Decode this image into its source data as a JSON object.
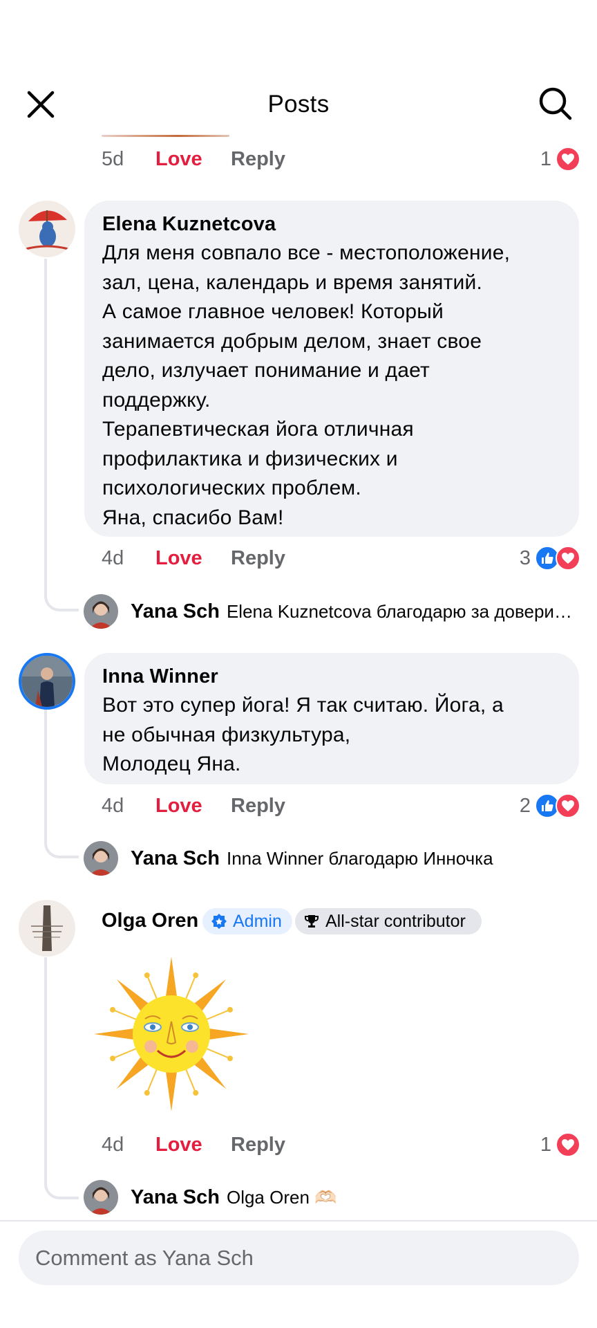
{
  "header": {
    "title": "Posts",
    "close_icon": "close-icon",
    "search_icon": "search-icon"
  },
  "colors": {
    "love": "#e41e3f",
    "like": "#1877f2",
    "heart": "#f33e58",
    "bubble": "#f0f2f5",
    "muted": "#65676b"
  },
  "labels": {
    "love": "Love",
    "reply": "Reply"
  },
  "prev_comment": {
    "time": "5d",
    "reactions": "1"
  },
  "comments": [
    {
      "author": "Elena Kuznetcova",
      "text": "Для меня совпало все - местоположение,\nзал, цена, календарь и время занятий.\nА самое главное человек! Который\nзанимается добрым делом, знает свое\nдело, излучает понимание и дает\nподдержку.\nТерапевтическая йога отличная\nпрофилактика и физических и\nпсихологических проблем.\nЯна, спасибо Вам!",
      "time": "4d",
      "reactions": "3",
      "reply": {
        "author": "Yana Sch",
        "text": "Elena Kuznetcova благодарю за довери…"
      }
    },
    {
      "author": "Inna Winner",
      "text": "Вот это супер йога! Я так считаю. Йога, а\nне обычная физкультура,\nМолодец Яна.",
      "time": "4d",
      "reactions": "2",
      "reply": {
        "author": "Yana Sch",
        "text": "Inna Winner благодарю Инночка"
      }
    },
    {
      "author": "Olga Oren",
      "badges": {
        "admin": "Admin",
        "allstar": "All-star contributor"
      },
      "time": "4d",
      "reactions": "1",
      "reply": {
        "author": "Yana Sch",
        "text": "Olga Oren 🫶🏻"
      }
    }
  ],
  "composer": {
    "placeholder": "Comment as Yana Sch"
  }
}
